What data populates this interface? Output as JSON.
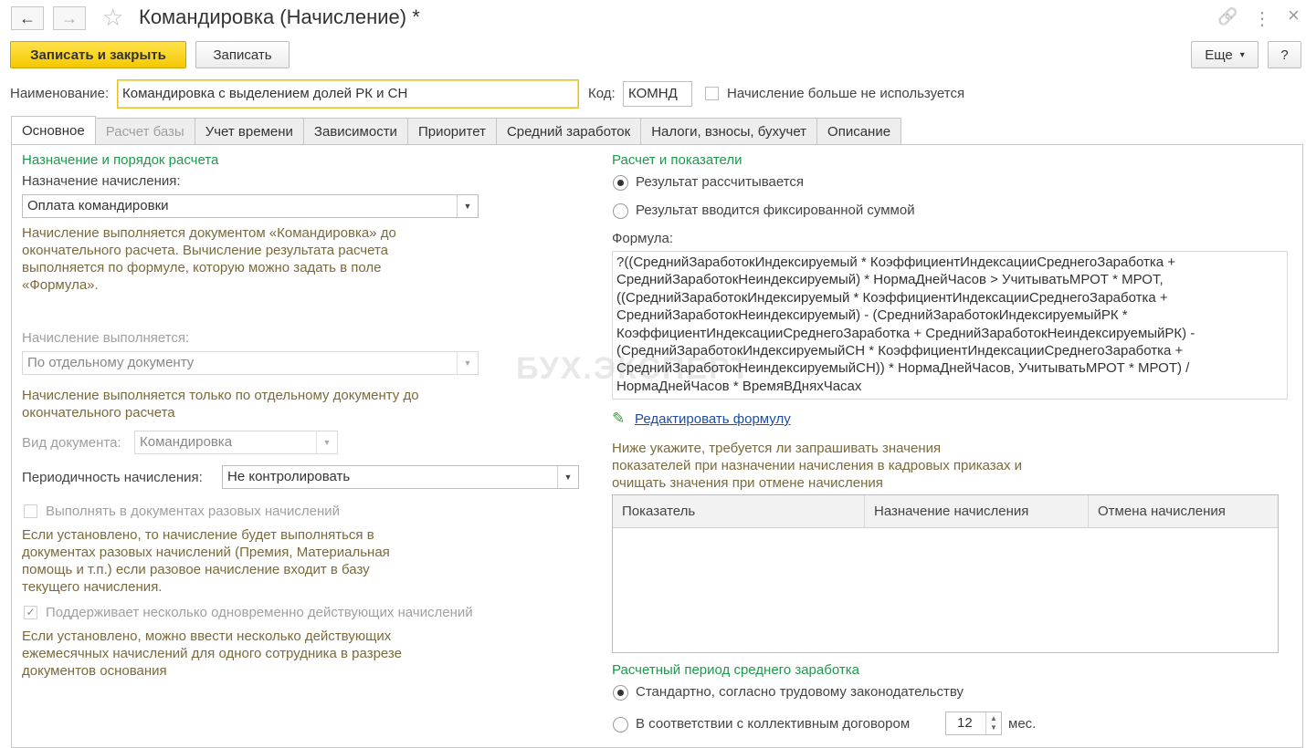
{
  "window": {
    "title": "Командировка (Начисление) *",
    "back_icon": "←",
    "forward_icon": "→",
    "star_icon": "☆",
    "link_icon": "🔗",
    "more_icon": "⋮",
    "close_icon": "×"
  },
  "toolbar": {
    "save_close": "Записать и закрыть",
    "save": "Записать",
    "more": "Еще",
    "more_arrow": "▾",
    "help": "?"
  },
  "header": {
    "name_label": "Наименование:",
    "name_value": "Командировка с выделением долей РК и СН",
    "code_label": "Код:",
    "code_value": "КОМНД",
    "unused_label": "Начисление больше не используется"
  },
  "tabs": [
    {
      "label": "Основное"
    },
    {
      "label": "Расчет базы"
    },
    {
      "label": "Учет времени"
    },
    {
      "label": "Зависимости"
    },
    {
      "label": "Приоритет"
    },
    {
      "label": "Средний заработок"
    },
    {
      "label": "Налоги, взносы, бухучет"
    },
    {
      "label": "Описание"
    }
  ],
  "left": {
    "group_title": "Назначение и порядок расчета",
    "purpose_label": "Назначение начисления:",
    "purpose_value": "Оплата командировки",
    "purpose_hint": [
      "Начисление выполняется документом «Командировка» до",
      "окончательного расчета. Вычисление результата расчета",
      "выполняется по формуле, которую можно задать в поле",
      "«Формула»."
    ],
    "exec_label": "Начисление выполняется:",
    "exec_value": "По отдельному документу",
    "exec_hint": [
      "Начисление выполняется только по отдельному документу до",
      "окончательного расчета"
    ],
    "doc_type_label": "Вид документа:",
    "doc_type_value": "Командировка",
    "period_label": "Периодичность начисления:",
    "period_value": "Не контролировать",
    "oneoff_label": "Выполнять в документах разовых начислений",
    "oneoff_hint": [
      "Если установлено, то начисление будет выполняться в",
      "документах разовых начислений (Премия, Материальная",
      "помощь и т.п.) если разовое начисление входит в базу",
      "текущего начисления."
    ],
    "multi_label": "Поддерживает несколько одновременно действующих начислений",
    "multi_hint": [
      "Если установлено, можно ввести несколько действующих",
      "ежемесячных начислений для одного сотрудника в разрезе",
      "документов основания"
    ],
    "check_mark": "✓"
  },
  "right": {
    "group_title": "Расчет и показатели",
    "radio_calc": "Результат рассчитывается",
    "radio_fixed": "Результат вводится фиксированной суммой",
    "formula_label": "Формула:",
    "formula_lines": [
      "?((СреднийЗаработокИндексируемый * КоэффициентИндексацииСреднегоЗаработка +",
      "СреднийЗаработокНеиндексируемый) * НормаДнейЧасов > УчитыватьМРОТ * МРОТ,",
      "((СреднийЗаработокИндексируемый * КоэффициентИндексацииСреднегоЗаработка +",
      "СреднийЗаработокНеиндексируемый) - (СреднийЗаработокИндексируемыйРК *",
      "КоэффициентИндексацииСреднегоЗаработка + СреднийЗаработокНеиндексируемыйРК) -",
      "(СреднийЗаработокИндексируемыйСН * КоэффициентИндексацииСреднегоЗаработка +",
      "СреднийЗаработокНеиндексируемыйСН)) * НормаДнейЧасов, УчитыватьМРОТ * МРОТ) /",
      "НормаДнейЧасов * ВремяВДняхЧасах"
    ],
    "edit_formula": "Редактировать формулу",
    "pencil_icon": "✎",
    "indicators_hint": [
      "Ниже укажите, требуется ли запрашивать значения",
      "показателей при назначении начисления в кадровых приказах и",
      "очищать значения при отмене начисления"
    ],
    "table_headers": [
      "Показатель",
      "Назначение начисления",
      "Отмена начисления"
    ],
    "avg_group_title": "Расчетный период среднего заработка",
    "radio_standard": "Стандартно, согласно трудовому законодательству",
    "radio_collective": "В соответствии с коллективным договором",
    "months_value": "12",
    "months_unit": "мес."
  },
  "watermark": "БУХ.ЭКСПЕРТ"
}
